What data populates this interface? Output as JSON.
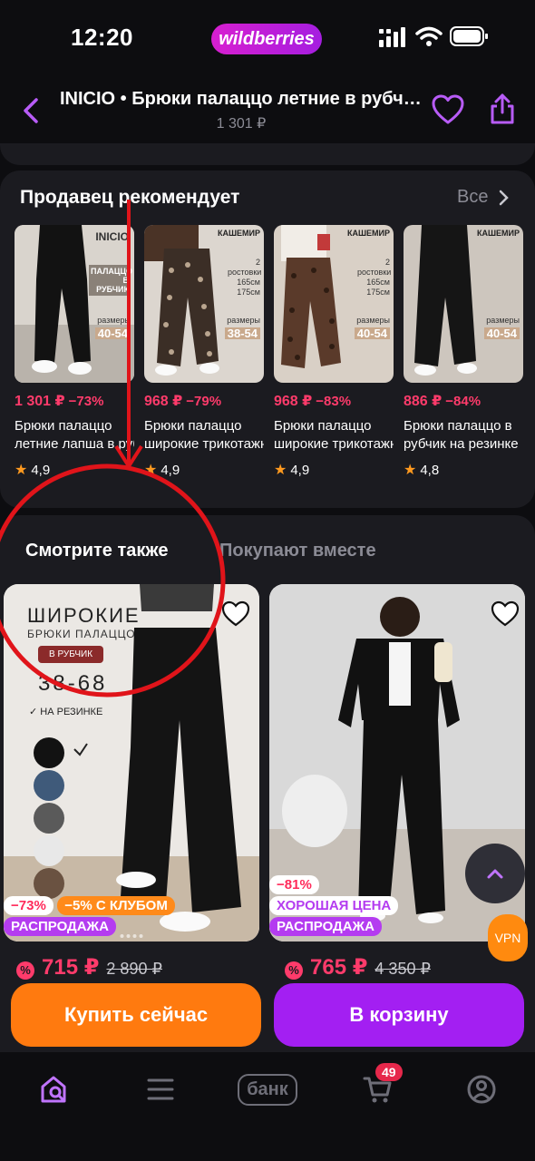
{
  "status_bar": {
    "time": "12:20",
    "brand": "wildberries"
  },
  "header": {
    "title": "INICIO • Брюки палаццо летние в рубчик",
    "price": "1 301 ₽"
  },
  "recommended": {
    "title": "Продавец рекомендует",
    "see_all": "Все",
    "items": [
      {
        "price": "1 301 ₽",
        "discount": "−73%",
        "name": "Брюки палаццо",
        "name2": "летние лапша в рубчик",
        "rating": "4,9",
        "tag": "INICIO",
        "tag2": "ПАЛАЦЦО В РУБЧИК",
        "sizes": "40-54",
        "sizes_label": "размеры",
        "img_color": "#cfcac4"
      },
      {
        "price": "968 ₽",
        "discount": "−79%",
        "name": "Брюки палаццо",
        "name2": "широкие трикотажные",
        "rating": "4,9",
        "tag": "КАШЕМИР",
        "tag2": "",
        "sizes": "38-54",
        "sizes_label": "размеры",
        "growth": "2 ростовки 165см 175см",
        "img_color": "#d8d2cc"
      },
      {
        "price": "968 ₽",
        "discount": "−83%",
        "name": "Брюки палаццо",
        "name2": "широкие трикотажные",
        "rating": "4,9",
        "tag": "КАШЕМИР",
        "tag2": "",
        "sizes": "40-54",
        "sizes_label": "размеры",
        "growth": "2 ростовки 165см 175см",
        "img_color": "#d7cfc7"
      },
      {
        "price": "886 ₽",
        "discount": "−84%",
        "name": "Брюки палаццо в",
        "name2": "рубчик на резинке",
        "rating": "4,8",
        "tag": "КАШЕМИР",
        "tag2": "",
        "sizes": "40-54",
        "sizes_label": "размеры",
        "img_color": "#cbc4bd"
      }
    ]
  },
  "tabs": {
    "active": "Смотрите также",
    "inactive": "Покупают вместе"
  },
  "products": [
    {
      "promo_title": "ШИРОКИЕ",
      "promo_sub": "БРЮКИ ПАЛАЦЦО",
      "promo_chip": "В РУБЧИК",
      "promo_sizes": "38-68",
      "promo_check": "НА РЕЗИНКЕ",
      "badge1": "−73%",
      "badge2": "−5% С КЛУБОМ",
      "badge3": "РАСПРОДАЖА",
      "price": "715 ₽",
      "old_price": "2 890 ₽"
    },
    {
      "badge1": "−81%",
      "badge2": "ХОРОШАЯ ЦЕНА",
      "badge3": "РАСПРОДАЖА",
      "price": "765 ₽",
      "old_price": "4 350 ₽"
    }
  ],
  "floating": {
    "vpn": "VPN"
  },
  "actions": {
    "buy_now": "Купить сейчас",
    "add_to_cart": "В корзину"
  },
  "bottom_nav": {
    "bank": "банк",
    "cart_count": "49"
  },
  "colors": {
    "accent_purple": "#a31ff2",
    "accent_orange": "#ff7a0f",
    "price_red": "#ff3b6b",
    "annotation_red": "#e0141a"
  }
}
